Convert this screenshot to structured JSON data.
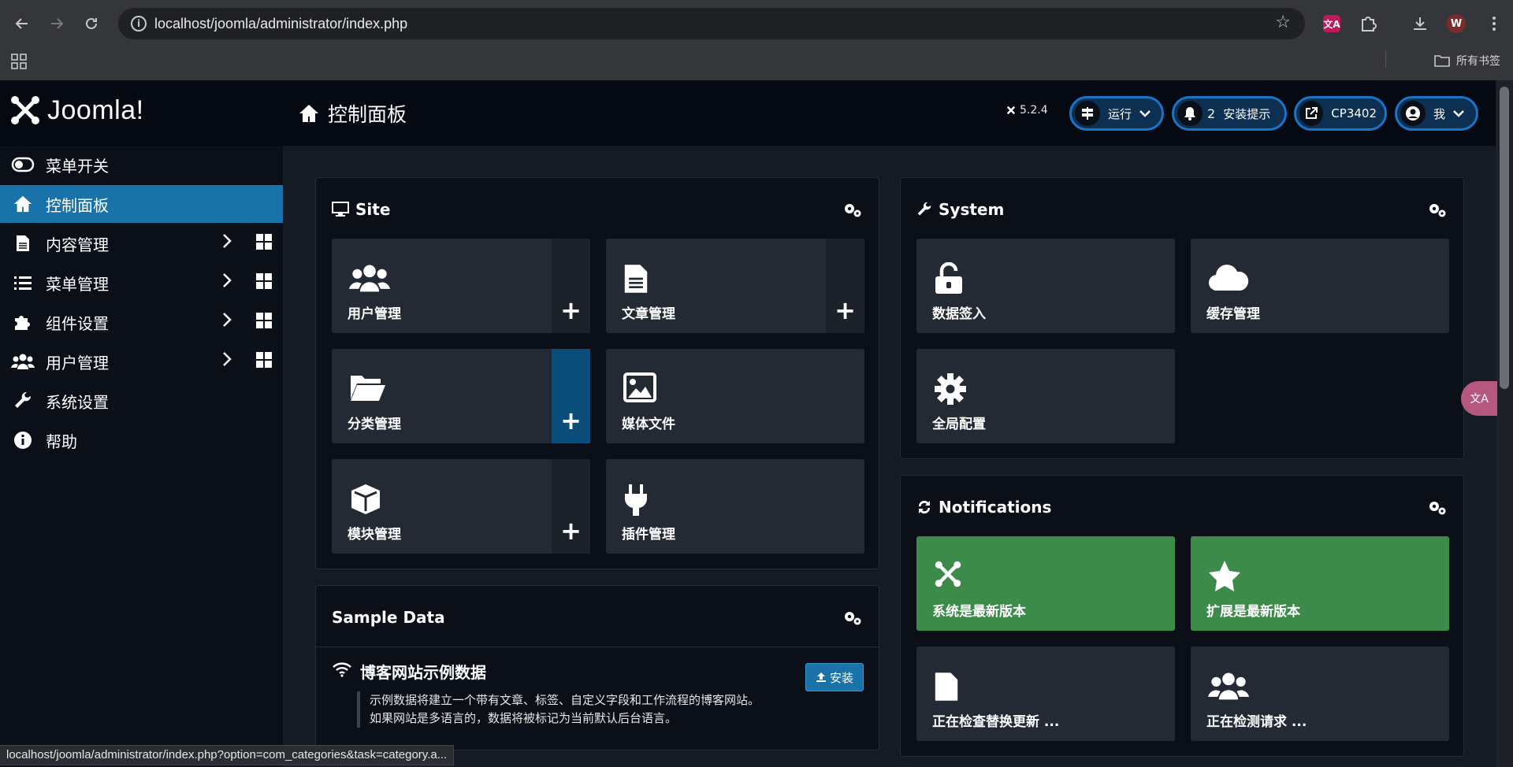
{
  "browser": {
    "url": "localhost/joomla/administrator/index.php",
    "bookmarks_label": "所有书签",
    "profile_initial": "W",
    "translate_ext": "文A",
    "status_url": "localhost/joomla/administrator/index.php?option=com_categories&task=category.a..."
  },
  "header": {
    "logo_text": "Joomla!",
    "title": "控制面板",
    "version": "5.2.4",
    "run_label": "运行",
    "notifications_count": "2",
    "notifications_label": "安装提示",
    "site_label": "CP3402",
    "user_label": "我"
  },
  "sidebar": {
    "items": [
      {
        "label": "菜单开关",
        "icon": "toggle-icon"
      },
      {
        "label": "控制面板",
        "icon": "home-icon"
      },
      {
        "label": "内容管理",
        "icon": "file-icon"
      },
      {
        "label": "菜单管理",
        "icon": "list-icon"
      },
      {
        "label": "组件设置",
        "icon": "puzzle-icon"
      },
      {
        "label": "用户管理",
        "icon": "users-icon"
      },
      {
        "label": "系统设置",
        "icon": "wrench-icon"
      },
      {
        "label": "帮助",
        "icon": "info-icon"
      }
    ]
  },
  "site": {
    "title": "Site",
    "tiles": [
      {
        "label": "用户管理",
        "icon": "users-icon"
      },
      {
        "label": "文章管理",
        "icon": "file-icon"
      },
      {
        "label": "分类管理",
        "icon": "folder-open-icon"
      },
      {
        "label": "媒体文件",
        "icon": "image-icon"
      },
      {
        "label": "模块管理",
        "icon": "cube-icon"
      },
      {
        "label": "插件管理",
        "icon": "plug-icon"
      }
    ]
  },
  "system": {
    "title": "System",
    "tiles": [
      {
        "label": "数据签入",
        "icon": "unlock-icon"
      },
      {
        "label": "缓存管理",
        "icon": "cloud-icon"
      },
      {
        "label": "全局配置",
        "icon": "gear-icon"
      }
    ]
  },
  "notifications": {
    "title": "Notifications",
    "tiles": [
      {
        "label": "系统是最新版本",
        "icon": "joomla-icon"
      },
      {
        "label": "扩展是最新版本",
        "icon": "star-icon"
      },
      {
        "label": "正在检查替换更新 ...",
        "icon": "file-icon"
      },
      {
        "label": "正在检测请求 ...",
        "icon": "users-icon"
      }
    ]
  },
  "sample_data": {
    "title": "Sample Data",
    "item_title": "博客网站示例数据",
    "install_label": "安装",
    "desc_line1": "示例数据将建立一个带有文章、标签、自定义字段和工作流程的博客网站。",
    "desc_line2": "如果网站是多语言的，数据将被标记为当前默认后台语言。"
  },
  "colors": {
    "accent": "#1a73a8",
    "success": "#3d8b4b",
    "header_bg": "#050912"
  }
}
